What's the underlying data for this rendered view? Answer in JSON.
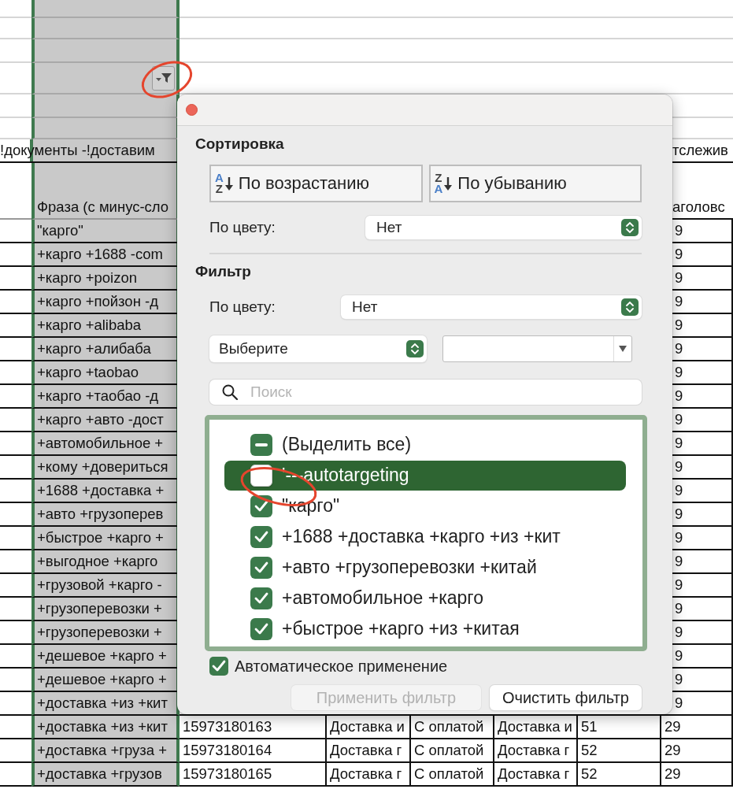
{
  "sheet": {
    "title_row": {
      "column_b": "!документы -!доставим",
      "column_h": "тслежив"
    },
    "header_row": {
      "column_b": "Фраза (с минус-сло",
      "column_h": "аголовс"
    },
    "rows": [
      {
        "column_b": "\"карго\"",
        "column_h": "9"
      },
      {
        "column_b": "+карго +1688 -com",
        "column_h": "9"
      },
      {
        "column_b": "+карго +poizon",
        "column_h": "9"
      },
      {
        "column_b": "+карго +пойзон -д",
        "column_h": "9"
      },
      {
        "column_b": "+карго +alibaba",
        "column_h": "9"
      },
      {
        "column_b": "+карго +алибаба",
        "column_h": "9"
      },
      {
        "column_b": "+карго +taobao",
        "column_h": "9"
      },
      {
        "column_b": "+карго +таобао -д",
        "column_h": "9"
      },
      {
        "column_b": "+карго +авто -дост",
        "column_h": "9"
      },
      {
        "column_b": "+автомобильное +",
        "column_h": "9"
      },
      {
        "column_b": "+кому +довериться",
        "column_h": "9"
      },
      {
        "column_b": "+1688 +доставка +",
        "column_h": "9"
      },
      {
        "column_b": "+авто +грузоперев",
        "column_h": "9"
      },
      {
        "column_b": "+быстрое +карго +",
        "column_h": "9"
      },
      {
        "column_b": "+выгодное +карго",
        "column_h": "9"
      },
      {
        "column_b": "+грузовой +карго -",
        "column_h": "9"
      },
      {
        "column_b": "+грузоперевозки +",
        "column_h": "9"
      },
      {
        "column_b": "+грузоперевозки +",
        "column_h": "9"
      },
      {
        "column_b": "+дешевое +карго +",
        "column_h": "9"
      },
      {
        "column_b": "+дешевое +карго +",
        "column_h": "9"
      },
      {
        "column_b": "+доставка +из +кит",
        "column_h": "9"
      },
      {
        "column_b": "+доставка +из +кит",
        "column_c": "15973180163",
        "column_d": "Доставка и",
        "column_e": "С оплатой",
        "column_f": "Доставка и",
        "column_g": "51",
        "column_h": "29"
      },
      {
        "column_b": "+доставка +груза +",
        "column_c": "15973180164",
        "column_d": "Доставка г",
        "column_e": "С оплатой",
        "column_f": "Доставка г",
        "column_g": "52",
        "column_h": "29"
      },
      {
        "column_b": "+доставка +грузов",
        "column_c": "15973180165",
        "column_d": "Доставка г",
        "column_e": "С оплатой",
        "column_f": "Доставка г",
        "column_g": "52",
        "column_h": "29"
      }
    ]
  },
  "filter_popover": {
    "sort_heading": "Сортировка",
    "sort_buttons": [
      {
        "kind": "ascending",
        "icon_top": "A",
        "icon_bottom": "Z",
        "label": "По возрастанию"
      },
      {
        "kind": "descending",
        "icon_top": "Z",
        "icon_bottom": "A",
        "label": "По убыванию"
      }
    ],
    "sort_color": {
      "label": "По цвету:",
      "value": "Нет"
    },
    "filter_heading": "Фильтр",
    "filter_color": {
      "label": "По цвету:",
      "value": "Нет"
    },
    "condition": {
      "value": "Выберите"
    },
    "search": {
      "placeholder": "Поиск"
    },
    "items": [
      {
        "label": "(Выделить все)",
        "checked": true,
        "partial": true,
        "selected": false
      },
      {
        "label": "'---autotargeting",
        "checked": false,
        "partial": false,
        "selected": true
      },
      {
        "label": "\"карго\"",
        "checked": true,
        "partial": false,
        "selected": false
      },
      {
        "label": "+1688 +доставка +карго +из +кит",
        "checked": true,
        "partial": false,
        "selected": false
      },
      {
        "label": "+авто +грузоперевозки +китай",
        "checked": true,
        "partial": false,
        "selected": false
      },
      {
        "label": "+автомобильное +карго",
        "checked": true,
        "partial": false,
        "selected": false
      },
      {
        "label": "+быстрое +карго +из +китая",
        "checked": true,
        "partial": false,
        "selected": false
      }
    ],
    "auto_apply": {
      "label": "Автоматическое применение",
      "checked": true
    },
    "buttons": [
      {
        "label": "Применить фильтр",
        "disabled": true
      },
      {
        "label": "Очистить фильтр",
        "disabled": false
      }
    ]
  }
}
